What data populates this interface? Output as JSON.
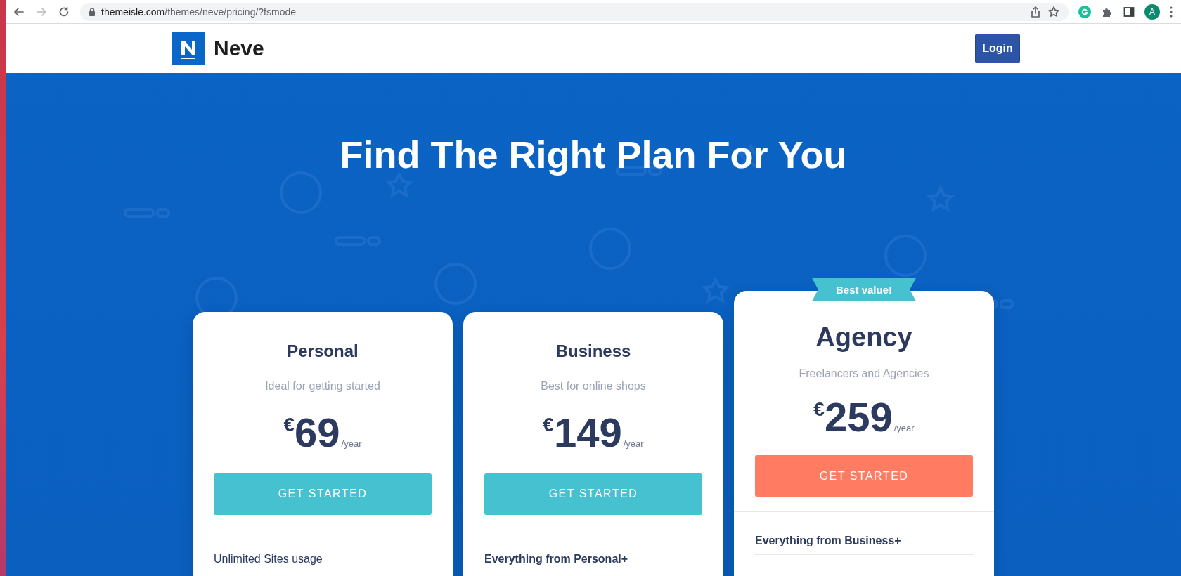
{
  "browser": {
    "url_host": "themeisle.com",
    "url_path": "/themes/neve/pricing/?fsmode",
    "forward_disabled": true,
    "profile_initial": "A"
  },
  "header": {
    "logo_text": "Neve",
    "login_label": "Login"
  },
  "hero": {
    "title": "Find The Right Plan For You"
  },
  "plans": [
    {
      "name": "Personal",
      "tagline": "Ideal for getting started",
      "currency": "€",
      "price": "69",
      "period": "/year",
      "button": "GET STARTED",
      "featured": false,
      "features": [
        {
          "kind": "item",
          "text": "Unlimited Sites usage"
        }
      ]
    },
    {
      "name": "Business",
      "tagline": "Best for online shops",
      "currency": "€",
      "price": "149",
      "period": "/year",
      "button": "GET STARTED",
      "featured": false,
      "features": [
        {
          "kind": "heading",
          "text": "Everything from Personal+"
        }
      ]
    },
    {
      "name": "Agency",
      "tagline": "Freelancers and Agencies",
      "currency": "€",
      "price": "259",
      "period": "/year",
      "button": "GET STARTED",
      "featured": true,
      "ribbon": "Best value!",
      "features": [
        {
          "kind": "heading",
          "text": "Everything from Business+"
        }
      ]
    }
  ]
}
